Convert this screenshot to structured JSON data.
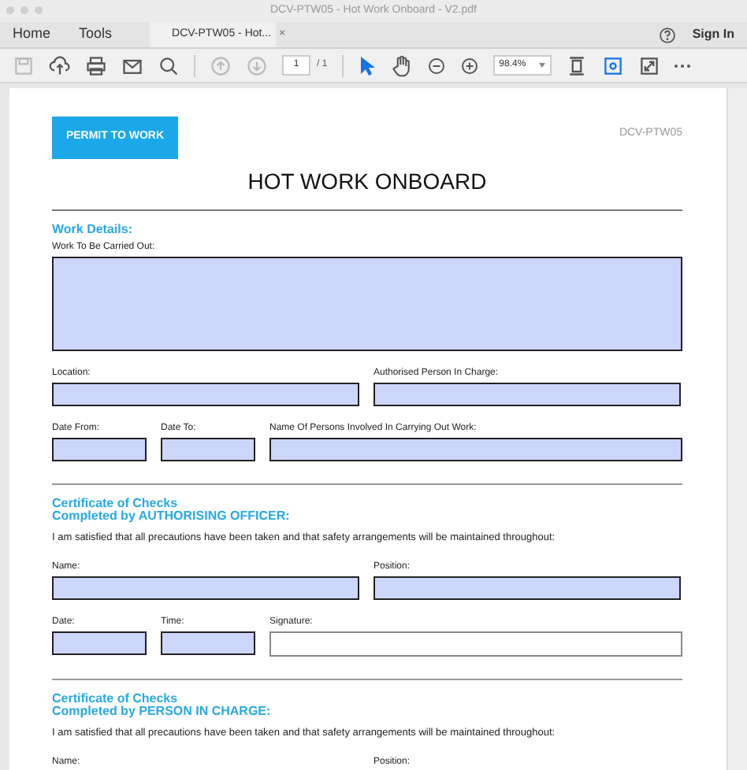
{
  "window": {
    "title": "DCV-PTW05 - Hot Work Onboard - V2.pdf"
  },
  "nav": [
    {
      "label": "Home"
    },
    {
      "label": "Tools"
    }
  ],
  "tabs": [
    {
      "label": "DCV-PTW05 - Hot...",
      "close": "×",
      "selected": true
    }
  ],
  "account": {
    "sign_in": "Sign In"
  },
  "toolbar": {
    "page": "1",
    "page_total": "/ 1",
    "zoom": "98.4%",
    "tools": [
      {
        "kind": "pointer",
        "selected": true
      },
      {
        "kind": "hand",
        "selected": false
      }
    ]
  },
  "document": {
    "badge": "PERMIT TO WORK",
    "code": "DCV-PTW05",
    "title": "HOT WORK ONBOARD",
    "sections": [
      {
        "heading": [
          "Work Details:"
        ],
        "fields": [
          {
            "label": "Work To Be Carried Out:",
            "kind": "area"
          },
          {
            "label": "Location:",
            "kind": "half"
          },
          {
            "label": "Authorised Person In Charge:",
            "kind": "half"
          },
          {
            "label": "Date From:",
            "kind": "short"
          },
          {
            "label": "Date To:",
            "kind": "short"
          },
          {
            "label": "Name Of Persons Involved In Carrying Out Work:",
            "kind": "fill"
          }
        ]
      },
      {
        "heading": [
          "Certificate of Checks",
          "Completed by AUTHORISING OFFICER:"
        ],
        "statement": "I am satisfied that all precautions have been taken and that safety arrangements will be maintained throughout:",
        "fields": [
          {
            "label": "Name:",
            "kind": "half"
          },
          {
            "label": "Position:",
            "kind": "half"
          },
          {
            "label": "Date:",
            "kind": "short"
          },
          {
            "label": "Time:",
            "kind": "short"
          },
          {
            "label": "Signature:",
            "kind": "signature"
          }
        ]
      },
      {
        "heading": [
          "Certificate of Checks",
          "Completed by PERSON IN CHARGE:"
        ],
        "statement": "I am satisfied that all precautions have been taken and that safety arrangements will be maintained throughout:",
        "fields": [
          {
            "label": "Name:",
            "kind": "label"
          },
          {
            "label": "Position:",
            "kind": "label"
          }
        ]
      }
    ]
  }
}
